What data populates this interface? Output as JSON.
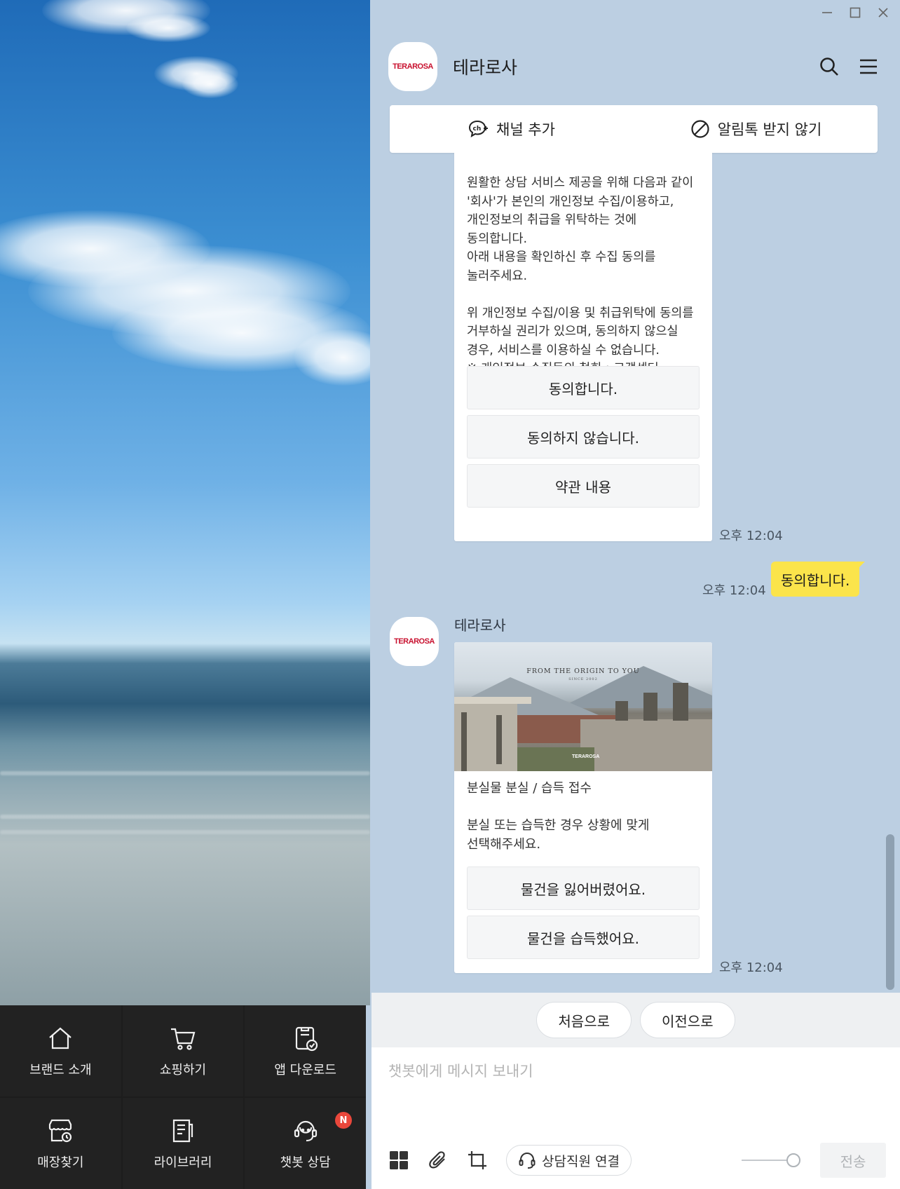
{
  "window": {
    "minimize_icon": "minimize-icon",
    "maximize_icon": "maximize-icon",
    "close_icon": "close-icon"
  },
  "header": {
    "title": "테라로사",
    "avatar_logo": "TERAROSA",
    "icons": [
      "search-icon",
      "menu-icon"
    ]
  },
  "action_bar": {
    "add_channel": "채널 추가",
    "block_notifications": "알림톡 받지 않기"
  },
  "messages": {
    "consent": {
      "text": "원활한 상담 서비스 제공을 위해 다음과 같이 '회사'가 본인의 개인정보 수집/이용하고, 개인정보의 취급을 위탁하는 것에 동의합니다.\n아래 내용을 확인하신 후 수집 동의를 눌러주세요.\n\n위 개인정보 수집/이용 및 취급위탁에 동의를 거부하실 권리가 있으며, 동의하지 않으실 경우, 서비스를 이용하실 수 없습니다.\n※ 개인정보 수집동의 철회 : 고객센터",
      "buttons": [
        "동의합니다.",
        "동의하지 않습니다.",
        "약관 내용"
      ],
      "time": "오후 12:04"
    },
    "user_reply": {
      "text": "동의합니다.",
      "time": "오후 12:04"
    },
    "lost_found": {
      "sender": "테라로사",
      "avatar_logo": "TERAROSA",
      "image_slogan": "FROM THE ORIGIN TO YOU",
      "image_since": "SINCE 2002",
      "image_brand": "TERAROSA",
      "text": "분실물 분실 / 습득 접수\n\n분실 또는 습득한 경우 상황에 맞게 선택해주세요.",
      "buttons": [
        "물건을 잃어버렸어요.",
        "물건을 습득했어요."
      ],
      "time": "오후 12:04"
    }
  },
  "quick_replies": [
    "처음으로",
    "이전으로"
  ],
  "composer": {
    "placeholder": "챗봇에게 메시지 보내기",
    "agent_button": "상담직원 연결",
    "send": "전송"
  },
  "left_menu": {
    "items": [
      {
        "label": "브랜드 소개",
        "icon": "home-icon"
      },
      {
        "label": "쇼핑하기",
        "icon": "cart-icon"
      },
      {
        "label": "앱 다운로드",
        "icon": "app-download-icon"
      },
      {
        "label": "매장찾기",
        "icon": "store-icon"
      },
      {
        "label": "라이브러리",
        "icon": "library-icon"
      },
      {
        "label": "챗봇 상담",
        "icon": "chatbot-icon",
        "badge": "N"
      }
    ]
  },
  "colors": {
    "chat_bg": "#bccfe2",
    "user_bubble": "#fbe44b",
    "badge": "#e9473b",
    "brand_red": "#c8102e",
    "menu_bg": "#222222"
  }
}
